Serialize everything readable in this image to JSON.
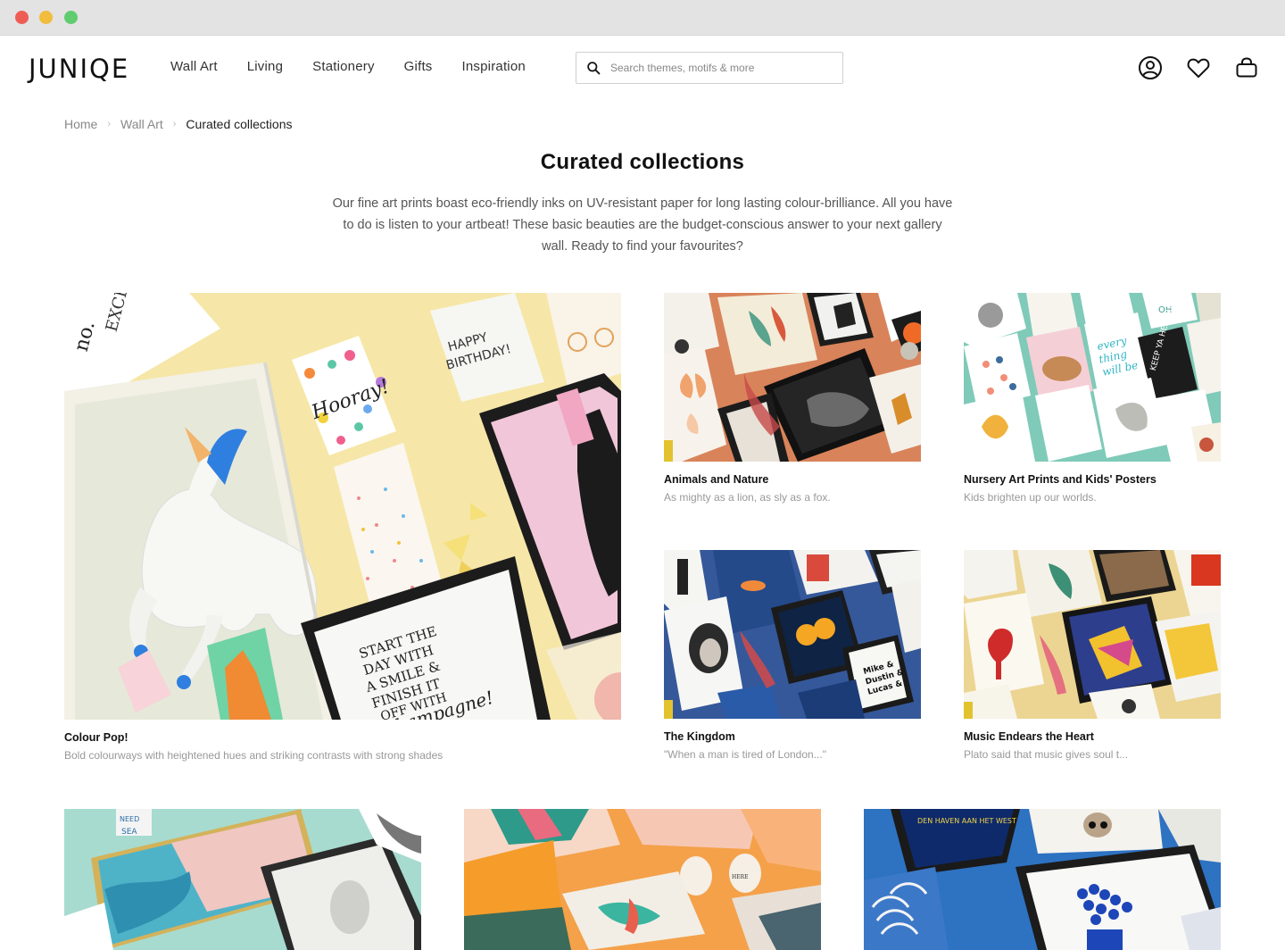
{
  "header": {
    "logo": "JUNIQE",
    "nav": [
      "Wall Art",
      "Living",
      "Stationery",
      "Gifts",
      "Inspiration"
    ],
    "search_placeholder": "Search themes, motifs & more",
    "icons": [
      "account-icon",
      "heart-icon",
      "shopping-bag-icon"
    ]
  },
  "breadcrumb": [
    "Home",
    "Wall Art",
    "Curated collections"
  ],
  "page": {
    "title": "Curated collections",
    "intro": "Our fine art prints boast eco-friendly inks on UV-resistant paper for long lasting colour-brilliance. All you have to do is listen to your artbeat! These basic beauties are the budget-conscious answer to your next gallery wall. Ready to find your favourites?"
  },
  "collections": [
    {
      "title": "Colour Pop!",
      "subtitle": "Bold colourways with heightened hues and striking contrasts with strong shades",
      "bg": "#f6e7a8"
    },
    {
      "title": "Animals and Nature",
      "subtitle": "As mighty as a lion, as sly as a fox.",
      "bg": "#d9835a"
    },
    {
      "title": "Nursery Art Prints and Kids' Posters",
      "subtitle": "Kids brighten up our worlds.",
      "bg": "#7fcab8"
    },
    {
      "title": "The Kingdom",
      "subtitle": "\"When a man is tired of London...\"",
      "bg": "#35589a"
    },
    {
      "title": "Music Endears the Heart",
      "subtitle": "Plato said that music gives soul t...",
      "bg": "#ecd592"
    }
  ],
  "more_collections_bg": [
    "#a7dbd0",
    "#f4a14a",
    "#2e72c2"
  ],
  "artwork_text": {
    "hooray": "Hooray!",
    "happy_birthday": "HAPPY BIRTHDAY!",
    "start_the_day": "START THE DAY WITH A SMILE & FINISH IT OFF WITH",
    "champagne": "champagne!",
    "every_thing": "every thing will be okay",
    "keep_ya_head_up": "KEEP YA HEAD UP",
    "mike": "Mike & Dustin & Lucas & Eleven."
  },
  "colors": {
    "text": "#111111",
    "muted": "#999999",
    "accent_unicorn_mane": "#2f7fe0"
  }
}
